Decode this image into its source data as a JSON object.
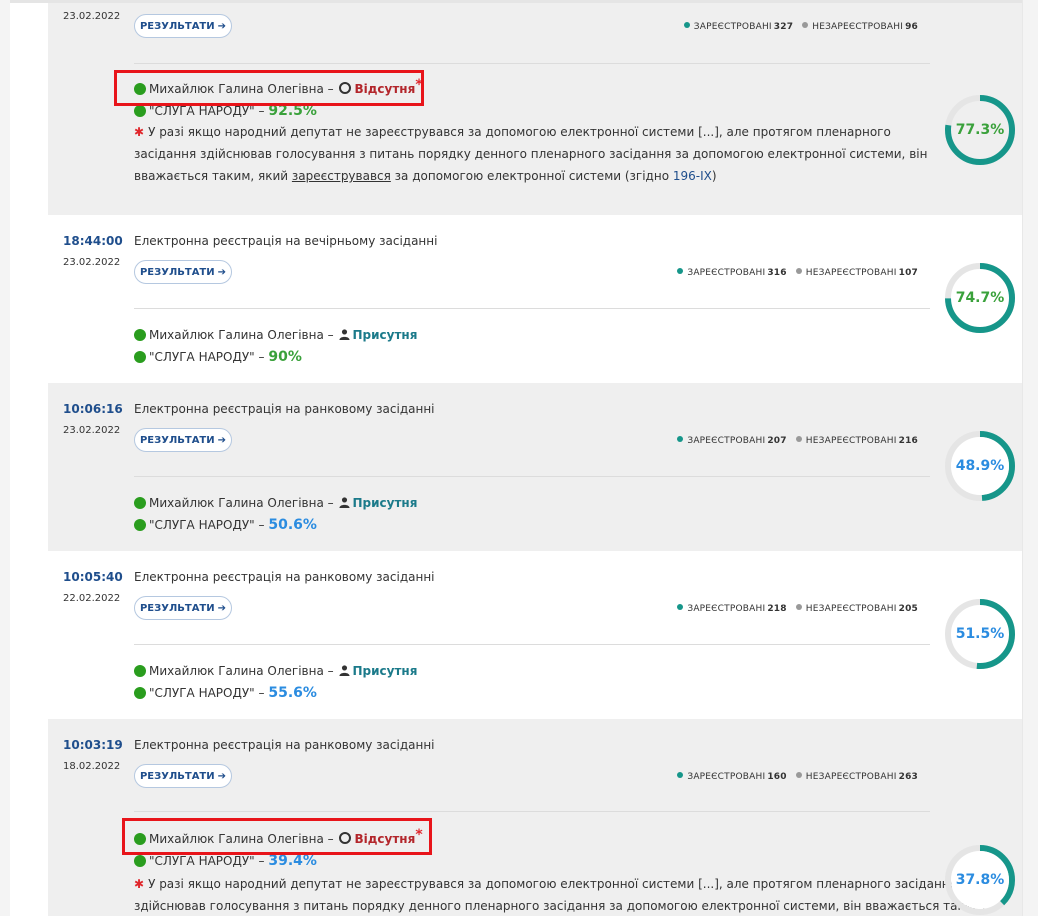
{
  "colors": {
    "accent_blue": "#1f4e8c",
    "teal": "#16968a",
    "absent_red": "#b3262b",
    "green": "#3aa13b",
    "blue_pct": "#2b8ce0",
    "highlight": "#e8141a"
  },
  "labels": {
    "results_button": "РЕЗУЛЬТАТИ",
    "registered": "ЗАРЕЄСТРОВАНІ",
    "unregistered": "НЕЗАРЕЄСТРОВАНІ",
    "deputy": "Михайлюк Галина Олегівна",
    "dash": "–",
    "absent": "Відсутня",
    "present": "Присутня",
    "party": "\"СЛУГА НАРОДУ\"",
    "note_part1": "У разі якщо народний депутат не зареєструвався за допомогою електронної системи [...], але протягом пленарного засідання здійснював голосування з питань порядку денного пленарного засідання за допомогою електронної системи, він вважається таким, який ",
    "note_underlined": "зареєструвався",
    "note_part2": " за допомогою електронної системи (згідно ",
    "note_link": "196-IX",
    "note_part3": ")",
    "note2_line1": "У разі якщо народний депутат не зареєструвався за допомогою електронної системи [...], але протягом пленарного засідання",
    "note2_line2": "здійснював голосування з питань порядку денного пленарного засідання за допомогою електронної системи, він вважається таким,"
  },
  "rows": [
    {
      "time": "",
      "date": "23.02.2022",
      "title": "",
      "registered": "327",
      "unregistered": "96",
      "status": "absent",
      "party_pct": "92.5%",
      "ring_pct": "77.3%",
      "ring_value": 77.3
    },
    {
      "time": "18:44:00",
      "date": "23.02.2022",
      "title": "Електронна реєстрація на вечірньому засіданні",
      "registered": "316",
      "unregistered": "107",
      "status": "present",
      "party_pct": "90%",
      "ring_pct": "74.7%",
      "ring_value": 74.7
    },
    {
      "time": "10:06:16",
      "date": "23.02.2022",
      "title": "Електронна реєстрація на ранковому засіданні",
      "registered": "207",
      "unregistered": "216",
      "status": "present",
      "party_pct": "50.6%",
      "ring_pct": "48.9%",
      "ring_value": 48.9
    },
    {
      "time": "10:05:40",
      "date": "22.02.2022",
      "title": "Електронна реєстрація на ранковому засіданні",
      "registered": "218",
      "unregistered": "205",
      "status": "present",
      "party_pct": "55.6%",
      "ring_pct": "51.5%",
      "ring_value": 51.5
    },
    {
      "time": "10:03:19",
      "date": "18.02.2022",
      "title": "Електронна реєстрація на ранковому засіданні",
      "registered": "160",
      "unregistered": "263",
      "status": "absent",
      "party_pct": "39.4%",
      "ring_pct": "37.8%",
      "ring_value": 37.8
    }
  ]
}
